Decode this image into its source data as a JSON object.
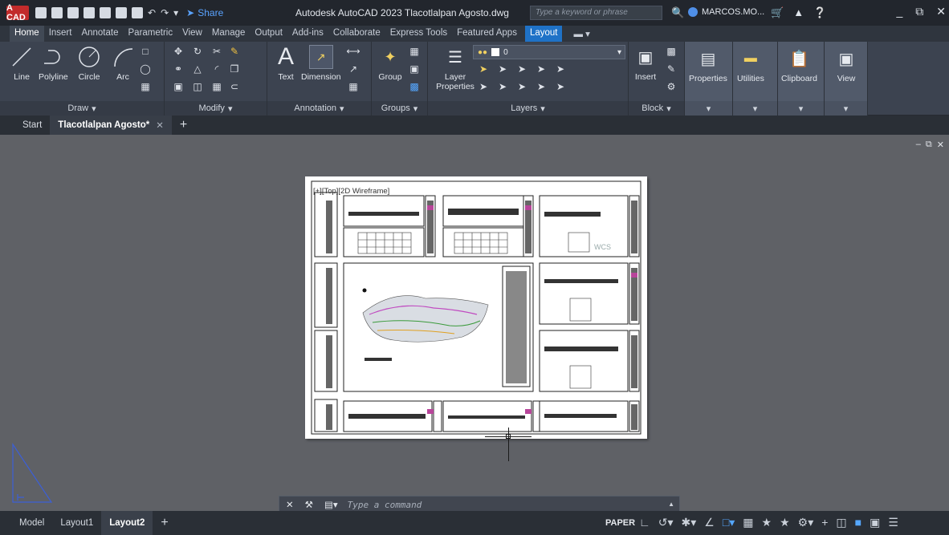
{
  "titlebar": {
    "logo": "A CAD",
    "share": "Share",
    "title": "Autodesk AutoCAD 2023   Tlacotlalpan Agosto.dwg",
    "search_placeholder": "Type a keyword or phrase",
    "user": "MARCOS.MO...",
    "win_min": "_",
    "win_restore": "⧉",
    "win_close": "✕"
  },
  "ribbon_tabs": [
    "Home",
    "Insert",
    "Annotate",
    "Parametric",
    "View",
    "Manage",
    "Output",
    "Add-ins",
    "Collaborate",
    "Express Tools",
    "Featured Apps"
  ],
  "ribbon_tab_active": "Layout",
  "panels": {
    "draw": {
      "title": "Draw",
      "tools": [
        "Line",
        "Polyline",
        "Circle",
        "Arc"
      ]
    },
    "modify": {
      "title": "Modify"
    },
    "annotation": {
      "title": "Annotation",
      "tools": [
        "Text",
        "Dimension"
      ]
    },
    "groups": {
      "title": "Groups",
      "tools": [
        "Group"
      ]
    },
    "layers": {
      "title": "Layers",
      "tool": "Layer Properties",
      "layer_value": "0"
    },
    "block": {
      "title": "Block",
      "tools": [
        "Insert"
      ]
    },
    "properties": {
      "label": "Properties"
    },
    "utilities": {
      "label": "Utilities"
    },
    "clipboard": {
      "label": "Clipboard"
    },
    "view": {
      "label": "View"
    }
  },
  "doc_tabs": {
    "start": "Start",
    "active": "Tlacotlalpan Agosto*",
    "close": "✕",
    "plus": "+"
  },
  "canvas": {
    "view_label": "[+][Top][2D Wireframe]",
    "wcs": "WCS",
    "controls": [
      "–",
      "⧉",
      "✕"
    ]
  },
  "command": {
    "placeholder": "Type a command"
  },
  "layout_tabs": [
    "Model",
    "Layout1",
    "Layout2"
  ],
  "layout_active": "Layout2",
  "status": {
    "paper": "PAPER"
  },
  "colors": {
    "accent": "#1f72c7",
    "canvas": "#5f6166",
    "sheet": "#ffffff"
  }
}
